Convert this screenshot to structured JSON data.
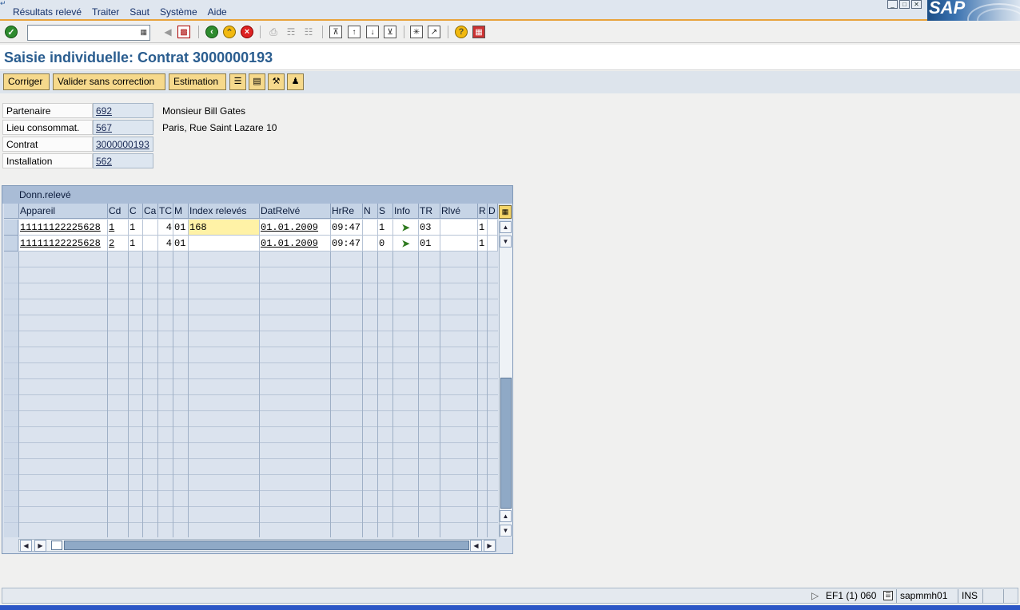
{
  "menubar": {
    "items": [
      "Résultats relevé",
      "Traiter",
      "Saut",
      "Système",
      "Aide"
    ]
  },
  "logo": {
    "text": "SAP"
  },
  "title": "Saisie individuelle: Contrat 3000000193",
  "app_toolbar": {
    "buttons": [
      "Corriger",
      "Valider sans correction",
      "Estimation"
    ]
  },
  "header": {
    "fields": [
      {
        "label": "Partenaire",
        "value": "692"
      },
      {
        "label": "Lieu consommat.",
        "value": "567"
      },
      {
        "label": "Contrat",
        "value": "3000000193"
      },
      {
        "label": "Installation",
        "value": "562"
      }
    ],
    "partner_name": "Monsieur Bill Gates",
    "address": "Paris, Rue Saint Lazare  10"
  },
  "table": {
    "title": "Donn.relevé",
    "columns": [
      "Appareil",
      "Cd",
      "C",
      "Ca",
      "TC",
      "M",
      "Index relevés",
      "DatRelvé",
      "HrRe",
      "N",
      "S",
      "Info",
      "TR",
      "Rlvé",
      "R",
      "D"
    ],
    "rows": [
      {
        "appareil": "11111122225628",
        "cd": "1",
        "c": "1",
        "ca": "",
        "tc": "4",
        "m": "01",
        "index": "168",
        "date": "01.01.2009",
        "hr": "09:47",
        "n": "",
        "s": "1",
        "tr": "03",
        "rlve": "",
        "r": "1",
        "d": ""
      },
      {
        "appareil": "11111122225628",
        "cd": "2",
        "c": "1",
        "ca": "",
        "tc": "4",
        "m": "01",
        "index": "",
        "date": "01.01.2009",
        "hr": "09:47",
        "n": "",
        "s": "0",
        "tr": "01",
        "rlve": "",
        "r": "1",
        "d": ""
      }
    ]
  },
  "statusbar": {
    "system": "EF1 (1) 060",
    "server": "sapmmh01",
    "mode": "INS"
  },
  "colors": {
    "title": "#2a5d8f",
    "button": "#f6d98c",
    "menu_underline": "#e8a33c",
    "table_bg": "#dbe3ee"
  }
}
